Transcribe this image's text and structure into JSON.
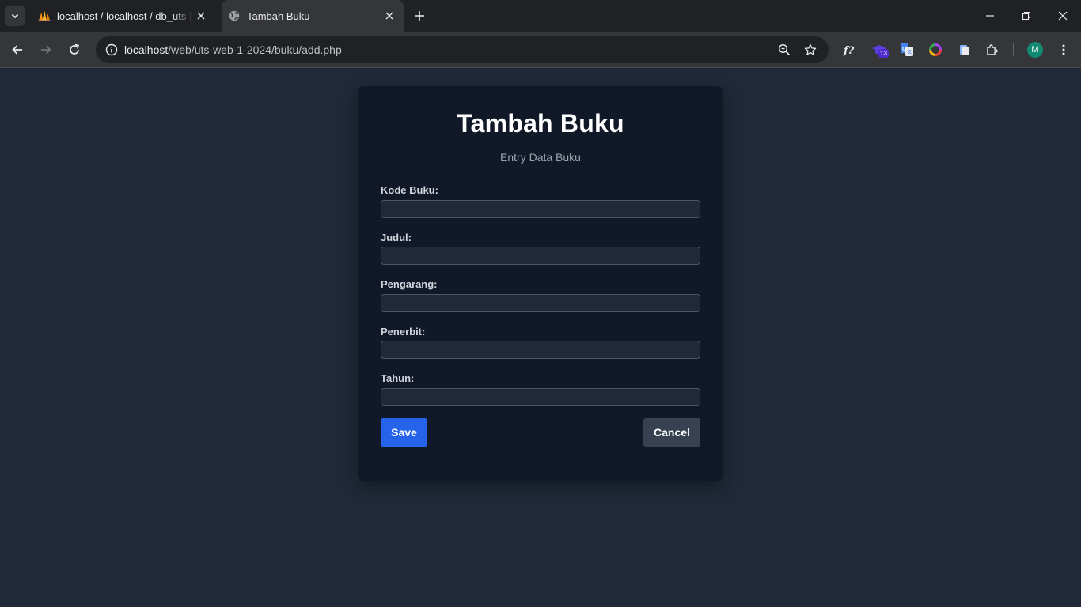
{
  "browser": {
    "tabs": [
      {
        "title": "localhost / localhost / db_uts | phpMyAdmin",
        "favicon": "phpmyadmin-icon",
        "active": false
      },
      {
        "title": "Tambah Buku",
        "favicon": "globe-icon",
        "active": true
      }
    ],
    "url_host": "localhost",
    "url_path": "/web/uts-web-1-2024/buku/add.php",
    "extension_badge": "13",
    "profile_initial": "M"
  },
  "page": {
    "title": "Tambah Buku",
    "subtitle": "Entry Data Buku",
    "fields": [
      {
        "label": "Kode Buku:",
        "value": ""
      },
      {
        "label": "Judul:",
        "value": ""
      },
      {
        "label": "Pengarang:",
        "value": ""
      },
      {
        "label": "Penerbit:",
        "value": ""
      },
      {
        "label": "Tahun:",
        "value": ""
      }
    ],
    "save_label": "Save",
    "cancel_label": "Cancel"
  },
  "colors": {
    "background": "#1f2937",
    "card": "#111827",
    "primary": "#2563eb",
    "secondary": "#374151"
  }
}
